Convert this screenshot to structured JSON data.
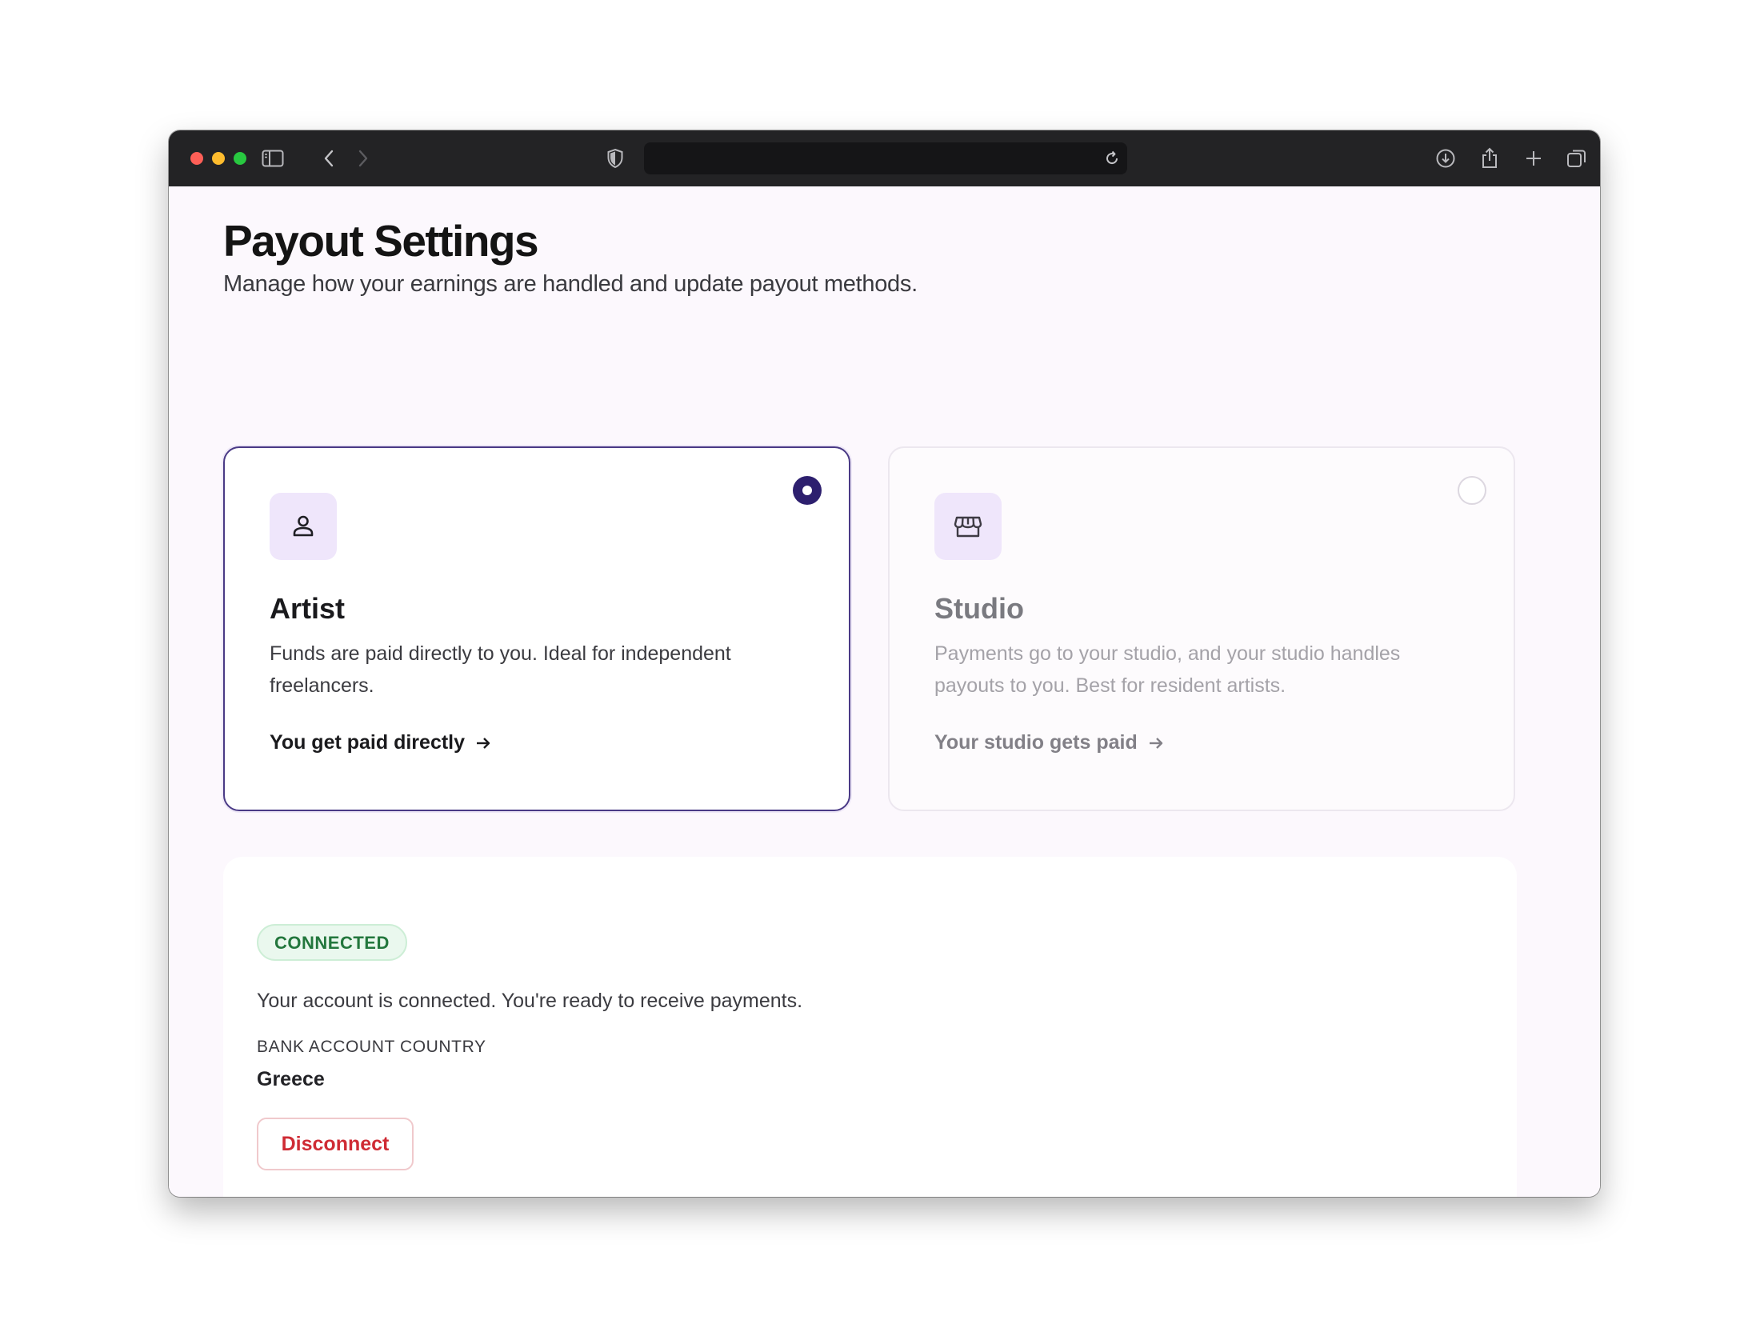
{
  "browser": {
    "address": "",
    "colors": {
      "close": "#fe5f57",
      "minimize": "#febc2e",
      "maximize": "#28c840"
    }
  },
  "page": {
    "title": "Payout Settings",
    "subtitle": "Manage how your earnings are handled and update payout methods."
  },
  "options": [
    {
      "title": "Artist",
      "icon": "user-icon",
      "selected": true,
      "description": "Funds are paid directly to you. Ideal for independent freelancers.",
      "link": "You get paid directly"
    },
    {
      "title": "Studio",
      "icon": "storefront-icon",
      "selected": false,
      "description": "Payments go to your studio, and your studio handles payouts to you. Best for resident artists.",
      "link": "Your studio gets paid"
    }
  ],
  "connection": {
    "status_badge": "CONNECTED",
    "status_text": "Your account is connected. You're ready to receive payments.",
    "country_label": "BANK ACCOUNT COUNTRY",
    "country_value": "Greece",
    "disconnect_label": "Disconnect"
  },
  "colors": {
    "accent": "#2d1f6e",
    "connected": "#23773d",
    "danger": "#cf2b34"
  }
}
